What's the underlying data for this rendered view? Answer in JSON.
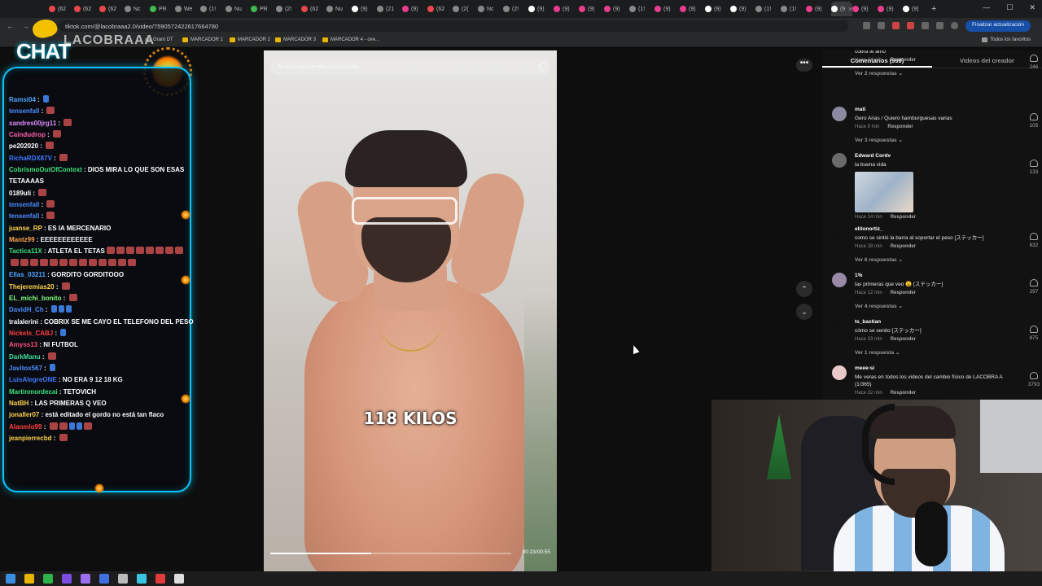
{
  "browser": {
    "tabs": [
      {
        "label": "(62",
        "color": "#e8474c"
      },
      {
        "label": "(62",
        "color": "#e8474c"
      },
      {
        "label": "(62",
        "color": "#e8474c"
      },
      {
        "label": "Nc",
        "color": "#888888"
      },
      {
        "label": "PR",
        "color": "#3fb950"
      },
      {
        "label": "We",
        "color": "#888888"
      },
      {
        "label": "(1!",
        "color": "#888888"
      },
      {
        "label": "Nu",
        "color": "#888888"
      },
      {
        "label": "PR",
        "color": "#3fb950"
      },
      {
        "label": "(2!",
        "color": "#888888"
      },
      {
        "label": "(62",
        "color": "#e8474c"
      },
      {
        "label": "Nu",
        "color": "#888888"
      },
      {
        "label": "(9)",
        "color": "#ffffff"
      },
      {
        "label": "(21",
        "color": "#888888"
      },
      {
        "label": "(9)",
        "color": "#e83e8c"
      },
      {
        "label": "(62",
        "color": "#e8474c"
      },
      {
        "label": "(2(",
        "color": "#888888"
      },
      {
        "label": "Nc",
        "color": "#888888"
      },
      {
        "label": "(2!",
        "color": "#888888"
      },
      {
        "label": "(9)",
        "color": "#ffffff"
      },
      {
        "label": "(9)",
        "color": "#e83e8c"
      },
      {
        "label": "(9)",
        "color": "#e83e8c"
      },
      {
        "label": "(9)",
        "color": "#e83e8c"
      },
      {
        "label": "(1!",
        "color": "#888888"
      },
      {
        "label": "(9)",
        "color": "#e83e8c"
      },
      {
        "label": "(9)",
        "color": "#e83e8c"
      },
      {
        "label": "(9)",
        "color": "#ffffff"
      },
      {
        "label": "(9)",
        "color": "#ffffff"
      },
      {
        "label": "(1!",
        "color": "#888888"
      },
      {
        "label": "(1!",
        "color": "#888888"
      },
      {
        "label": "(9)",
        "color": "#e83e8c"
      }
    ],
    "active_tab": {
      "label": "(9",
      "color": "#ffffff"
    },
    "tabs_after": [
      {
        "label": "(9)",
        "color": "#e83e8c"
      },
      {
        "label": "(9)",
        "color": "#e83e8c"
      },
      {
        "label": "(9)",
        "color": "#ffffff"
      }
    ],
    "new_tab": "+",
    "window_controls": {
      "minimize": "—",
      "maximize": "☐",
      "close": "✕"
    },
    "nav": {
      "back": "←",
      "forward": "→",
      "reload": "↻"
    },
    "url": "tiktok.com/@lacobraaa2.0/video/7590572422617664780",
    "update_button": "Finalizar actualización",
    "bookmarks": [
      {
        "label": "Grant DT",
        "icon": "globe"
      },
      {
        "label": "MARCADOR 1",
        "icon": "folder"
      },
      {
        "label": "MARCADOR 2",
        "icon": "folder"
      },
      {
        "label": "MARCADOR 3",
        "icon": "folder"
      },
      {
        "label": "MARCADOR 4 - ove...",
        "icon": "folder"
      }
    ],
    "all_bookmarks": "Todos los favoritos"
  },
  "overlay": {
    "title": "CHAT",
    "channel": "LACOBRAAA"
  },
  "chat": [
    {
      "user": "Ramsi04",
      "color": "#4da6ff",
      "msg": "",
      "emotes": [
        "blue"
      ]
    },
    {
      "user": "tensenfall",
      "color": "#4d8cff",
      "msg": "",
      "emotes": [
        "red"
      ]
    },
    {
      "user": "xandres00jrg11",
      "color": "#e08bff",
      "msg": "",
      "emotes": [
        "red"
      ]
    },
    {
      "user": "Caindudrop",
      "color": "#ff5fa8",
      "msg": "",
      "emotes": [
        "red"
      ]
    },
    {
      "user": "pe202020",
      "color": "#ffffff",
      "msg": "",
      "emotes": [
        "red"
      ]
    },
    {
      "user": "RichaRDX87V",
      "color": "#3f7bff",
      "msg": "",
      "emotes": [
        "red"
      ]
    },
    {
      "user": "CobrismoOutOfContext",
      "color": "#3de07a",
      "msg": "DIOS MIRA LO QUE SON ESAS",
      "emotes": []
    },
    {
      "user": "",
      "color": "#ffffff",
      "msg": "TETAAAAS",
      "emotes": []
    },
    {
      "user": "0189uli",
      "color": "#ffffff",
      "msg": "",
      "emotes": [
        "red"
      ]
    },
    {
      "user": "tensenfall",
      "color": "#4d8cff",
      "msg": "",
      "emotes": [
        "red"
      ]
    },
    {
      "user": "tensenfall",
      "color": "#4d8cff",
      "msg": "",
      "emotes": [
        "red"
      ]
    },
    {
      "user": "juanse_RP",
      "color": "#ffd34d",
      "msg": "ES IA MERCENARIO",
      "emotes": []
    },
    {
      "user": "Mantz99",
      "color": "#ffa54d",
      "msg": "EEEEEEEEEEEE",
      "emotes": []
    },
    {
      "user": "Tactica11X",
      "color": "#3de07a",
      "msg": "ATLETA EL TETAS",
      "emotes": [
        "red",
        "red",
        "red",
        "red",
        "red",
        "red",
        "red",
        "red"
      ]
    },
    {
      "user": "",
      "color": "#ffffff",
      "msg": "",
      "emotes": [
        "red",
        "red",
        "red",
        "red",
        "red",
        "red",
        "red",
        "red",
        "red",
        "red",
        "red",
        "red",
        "red"
      ]
    },
    {
      "user": "Ellas_03211",
      "color": "#4da6ff",
      "msg": "GORDITO GORDITOOO",
      "emotes": []
    },
    {
      "user": "Thejeremias20",
      "color": "#ffd34d",
      "msg": "",
      "emotes": [
        "red"
      ]
    },
    {
      "user": "EL_michi_bonito",
      "color": "#7fff7f",
      "msg": "",
      "emotes": [
        "red"
      ]
    },
    {
      "user": "DavidH_Ch",
      "color": "#4d8cff",
      "msg": "",
      "emotes": [
        "blue",
        "blue",
        "blue"
      ]
    },
    {
      "user": "tralalerini",
      "color": "#ffffff",
      "msg": "COBRIX SE ME CAYO EL TELEFONO DEL PESO",
      "emotes": []
    },
    {
      "user": "Nickels_CABJ",
      "color": "#ff3f3f",
      "msg": "",
      "emotes": [
        "blue"
      ]
    },
    {
      "user": "Amyss13",
      "color": "#ff4f7f",
      "msg": "NI FUTBOL",
      "emotes": []
    },
    {
      "user": "DarkManu",
      "color": "#3de0a0",
      "msg": "",
      "emotes": [
        "red"
      ]
    },
    {
      "user": "Javitox567",
      "color": "#4d8cff",
      "msg": "",
      "emotes": [
        "blue"
      ]
    },
    {
      "user": "LuisAlegreONE",
      "color": "#3f7bff",
      "msg": "NO ERA 9 12 18 KG",
      "emotes": []
    },
    {
      "user": "Martinmordecai",
      "color": "#3de07a",
      "msg": "TETOVICH",
      "emotes": []
    },
    {
      "user": "NatBH",
      "color": "#ffd34d",
      "msg": "LAS PRIMERAS Q VEO",
      "emotes": []
    },
    {
      "user": "jonaller07",
      "color": "#ffd34d",
      "msg": "está editado el gordo no está tan flaco",
      "emotes": []
    },
    {
      "user": "Alanmlo99",
      "color": "#ff3f3f",
      "msg": "",
      "emotes": [
        "red",
        "red",
        "blue",
        "blue",
        "red"
      ]
    },
    {
      "user": "jeanpierrecbd",
      "color": "#ffd34d",
      "msg": "",
      "emotes": [
        "red"
      ]
    }
  ],
  "video": {
    "search_placeholder": "Buscar contenido relacionado",
    "caption": "118 KILOS",
    "time": "00:23/00:55",
    "progress": 0.42
  },
  "controls": {
    "more": "•••",
    "up": "⌃",
    "down": "⌄"
  },
  "comments_panel": {
    "tab_comments": "Comentarios (999)",
    "tab_creator": "Videos del creador",
    "items": [
      {
        "user": "",
        "text": "cobra te amo",
        "time": "Hace 34 min",
        "reply": "Responder",
        "likes": "246",
        "replies": "Ver 2 respuestas ⌄",
        "avatar": "#444444",
        "image": false
      },
      {
        "user": "mati",
        "text": "Gero Arias / Quiero hamburguesas varias",
        "time": "Hace 9 min",
        "reply": "Responder",
        "likes": "105",
        "replies": "Ver 3 respuestas ⌄",
        "avatar": "#8a8aa0",
        "image": false
      },
      {
        "user": "Edward Cordv",
        "text": "la buena vida",
        "time": "Hace 14 min",
        "reply": "Responder",
        "likes": "133",
        "replies": "",
        "avatar": "#6b6b6b",
        "image": true
      },
      {
        "user": "elitonortiz_",
        "text": "como se sintió la barra al soportar el peso [ステッカー]",
        "time": "Hace 28 min",
        "reply": "Responder",
        "likes": "632",
        "replies": "Ver 6 respuestas ⌄",
        "avatar": "#111111",
        "image": false
      },
      {
        "user": "1%",
        "text": "las primeras que veo 😮 [ステッカー]",
        "time": "Hace 12 min",
        "reply": "Responder",
        "likes": "297",
        "replies": "Ver 4 respuestas ⌄",
        "avatar": "#9a8aa8",
        "image": false
      },
      {
        "user": "ts_bastian",
        "text": "cómo se sentio [ステッカー]",
        "time": "Hace 33 min",
        "reply": "Responder",
        "likes": "875",
        "replies": "Ver 1 respuesta ⌄",
        "avatar": "#111111",
        "image": false
      },
      {
        "user": "meee-si",
        "text": "Me veras en todos los videos del cambio físico de LACOBRA A (1/365)",
        "time": "Hace 32 min",
        "reply": "Responder",
        "likes": "3793",
        "replies": "",
        "avatar": "#e8c8c8",
        "image": false
      }
    ]
  },
  "taskbar": [
    {
      "name": "start",
      "color": "#3b8de0"
    },
    {
      "name": "explorer",
      "color": "#e8b400"
    },
    {
      "name": "chrome",
      "color": "#2fb14a"
    },
    {
      "name": "app-purple",
      "color": "#7a4de0"
    },
    {
      "name": "app-violet",
      "color": "#9c6ef0"
    },
    {
      "name": "app-blue",
      "color": "#3f6fe0"
    },
    {
      "name": "app-gray",
      "color": "#bbbbbb"
    },
    {
      "name": "app-teal",
      "color": "#39c5e0"
    },
    {
      "name": "app-red",
      "color": "#e03a3a"
    },
    {
      "name": "app-white",
      "color": "#dddddd"
    }
  ]
}
